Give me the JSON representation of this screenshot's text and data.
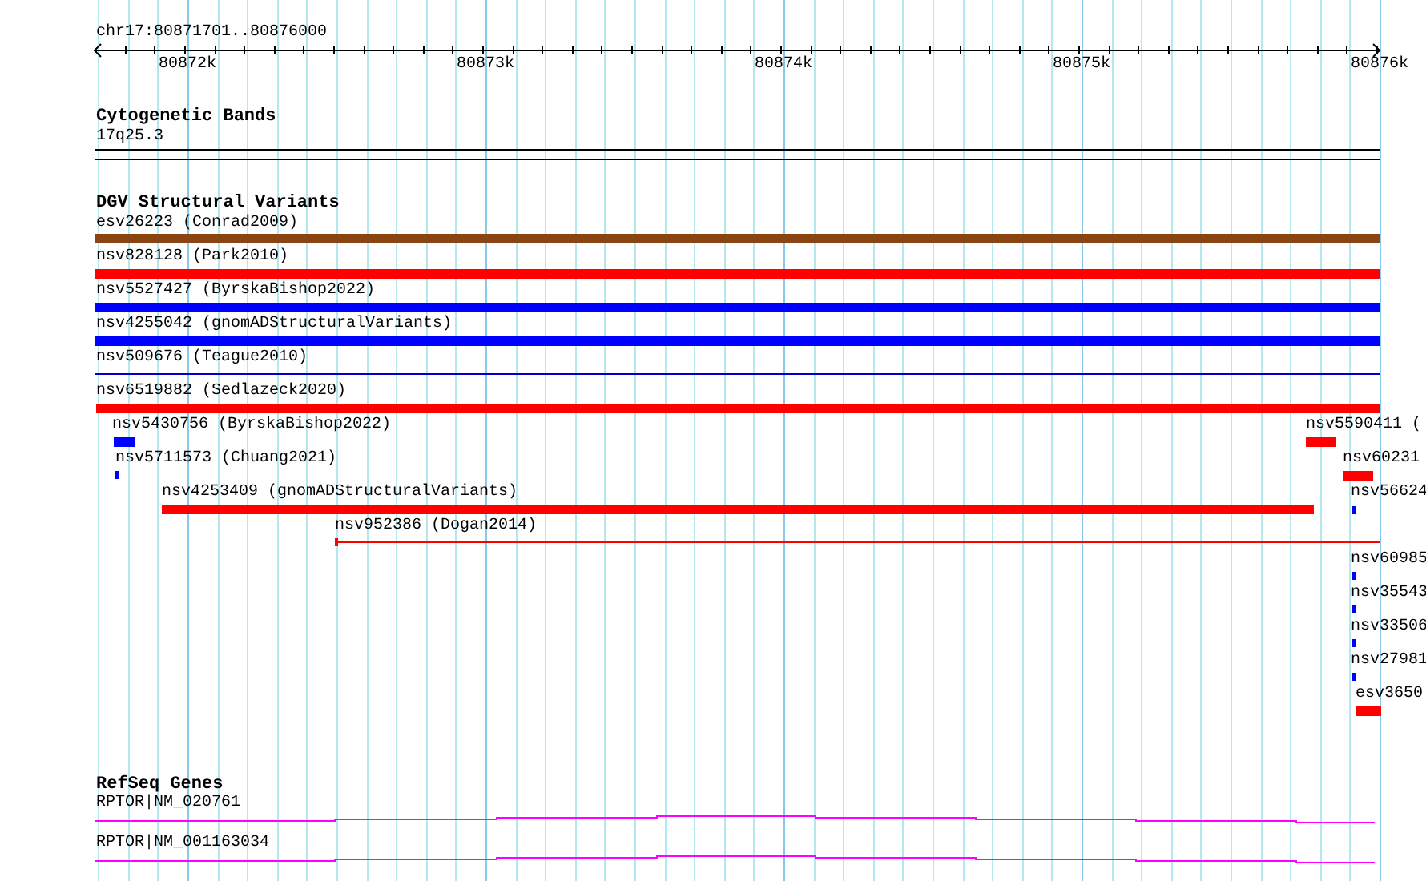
{
  "location": "chr17:80871701..80876000",
  "ruler": {
    "ticks": [
      "80872k",
      "80873k",
      "80874k",
      "80875k",
      "80876k"
    ]
  },
  "tracks": [
    {
      "kind": "bands",
      "title": "Cytogenetic Bands",
      "features": [
        {
          "label": "17q25.3"
        }
      ]
    },
    {
      "kind": "variants",
      "title": "DGV Structural Variants",
      "features": [
        {
          "label": "esv26223 (Conrad2009)",
          "color": "#8b4513"
        },
        {
          "label": "nsv828128 (Park2010)",
          "color": "#ff0000"
        },
        {
          "label": "nsv5527427 (ByrskaBishop2022)",
          "color": "#0000ff"
        },
        {
          "label": "nsv4255042 (gnomADStructuralVariants)",
          "color": "#0000ff"
        },
        {
          "label": "nsv509676 (Teague2010)",
          "color": "#0000cc"
        },
        {
          "label": "nsv6519882 (Sedlazeck2020)",
          "color": "#ff0000"
        },
        {
          "label": "nsv5430756 (ByrskaBishop2022)",
          "color": "#0000ff"
        },
        {
          "label": "nsv5590411 (",
          "color": "#ff0000"
        },
        {
          "label": "nsv5711573 (Chuang2021)",
          "color": "#0000ff"
        },
        {
          "label": "nsv60231",
          "color": "#ff0000"
        },
        {
          "label": "nsv4253409 (gnomADStructuralVariants)",
          "color": "#ff0000"
        },
        {
          "label": "nsv56624",
          "color": "#0000ff"
        },
        {
          "label": "nsv952386 (Dogan2014)",
          "color": "#ff0000"
        },
        {
          "label": "nsv60985",
          "color": "#0000ff"
        },
        {
          "label": "nsv35543",
          "color": "#0000ff"
        },
        {
          "label": "nsv33506",
          "color": "#0000ff"
        },
        {
          "label": "nsv27981",
          "color": "#0000ff"
        },
        {
          "label": "esv3650",
          "color": "#ff0000"
        }
      ]
    },
    {
      "kind": "genes",
      "title": "RefSeq Genes",
      "features": [
        {
          "label": "RPTOR|NM_020761"
        },
        {
          "label": "RPTOR|NM_001163034"
        }
      ]
    }
  ]
}
